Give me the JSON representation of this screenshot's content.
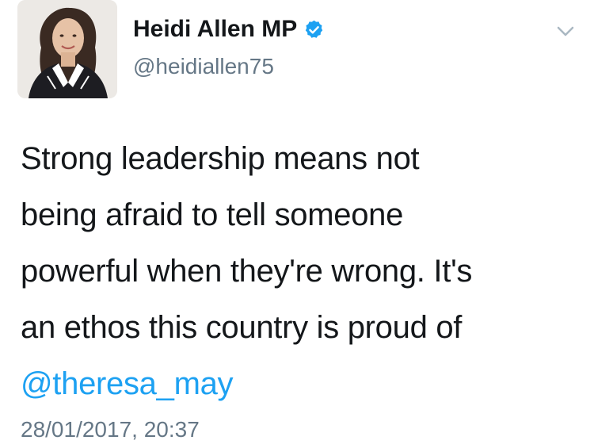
{
  "user": {
    "display_name": "Heidi Allen MP",
    "handle": "@heidiallen75",
    "verified_icon": "verified-badge-icon",
    "avatar_icon": "profile-photo"
  },
  "menu": {
    "icon": "chevron-down-icon"
  },
  "tweet": {
    "lines": [
      "Strong leadership means not",
      "being afraid to tell someone",
      "powerful when they're wrong. It's",
      "an ethos this country is proud of"
    ],
    "mention": "@theresa_may",
    "timestamp": "28/01/2017, 20:37"
  },
  "colors": {
    "text": "#14171a",
    "secondary": "#657786",
    "link": "#1da1f2"
  }
}
